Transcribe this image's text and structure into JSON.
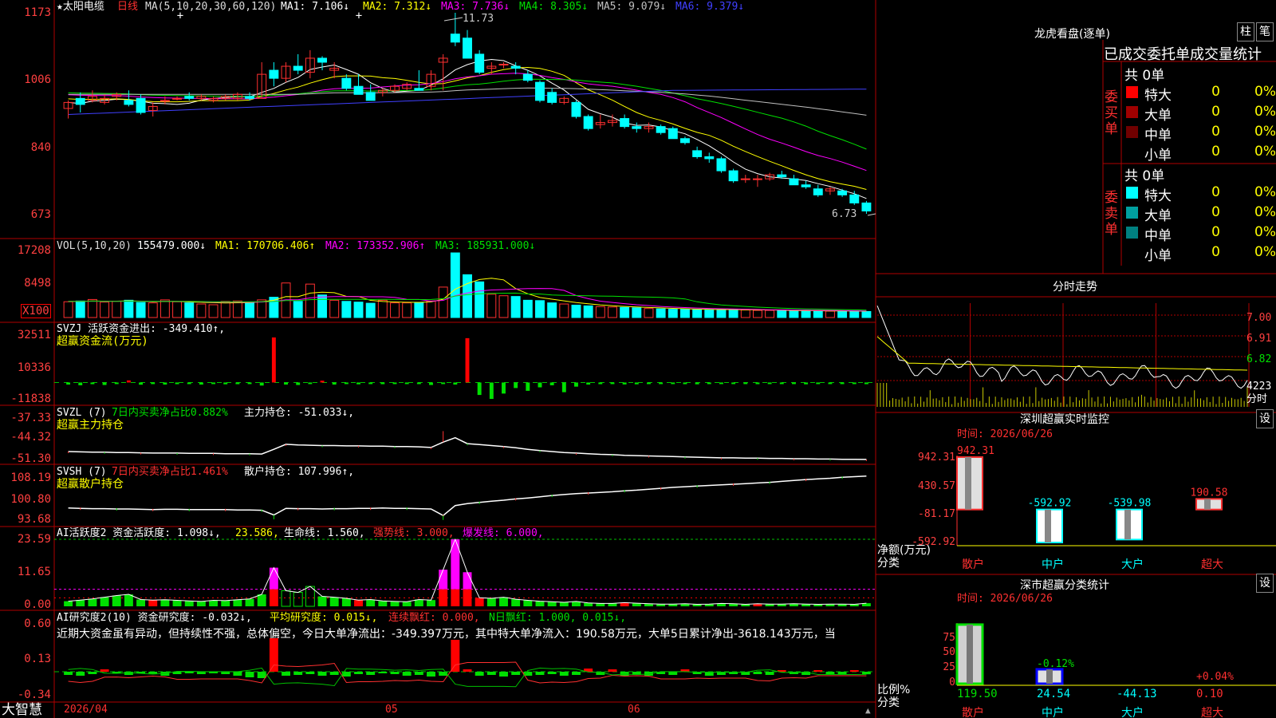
{
  "header": {
    "stock": "★太阳电缆",
    "period": "日线",
    "ma_params": "MA(5,10,20,30,60,120)",
    "ma_items": [
      {
        "label": "MA1: 7.106↓",
        "color": "#ffffff"
      },
      {
        "label": "MA2: 7.312↓",
        "color": "#ffff00"
      },
      {
        "label": "MA3: 7.736↓",
        "color": "#ff00ff"
      },
      {
        "label": "MA4: 8.305↓",
        "color": "#00e000"
      },
      {
        "label": "MA5: 9.079↓",
        "color": "#c0c0c0"
      },
      {
        "label": "MA6: 9.379↓",
        "color": "#4040ff"
      }
    ],
    "high_mark": "11.73",
    "low_mark": "6.73"
  },
  "price_axis": [
    "1173",
    "1006",
    "840",
    "673"
  ],
  "volume": {
    "header": "VOL(5,10,20)",
    "value": "155479.000↓",
    "items": [
      {
        "label": "MA1: 170706.406↑",
        "color": "#ffff00"
      },
      {
        "label": "MA2: 173352.906↑",
        "color": "#ff00ff"
      },
      {
        "label": "MA3: 185931.000↓",
        "color": "#00e000"
      }
    ],
    "axis": [
      "17208",
      "8498"
    ],
    "unit": "X100"
  },
  "svzj": {
    "header": "SVZJ  活跃资金进出: -349.410↑,",
    "sub": "超赢资金流(万元)",
    "axis": [
      "32511",
      "10336",
      "-11838"
    ]
  },
  "svzl": {
    "header_a": "SVZL (7)",
    "header_b": "7日内买卖净占比0.882%",
    "header_c": "主力持仓: -51.033↓,",
    "sub": "超赢主力持仓",
    "axis": [
      "-37.33",
      "-44.32",
      "-51.30"
    ]
  },
  "svsh": {
    "header_a": "SVSH (7)",
    "header_b": "7日内买卖净占比1.461%",
    "header_c": "散户持仓: 107.996↑,",
    "sub": "超赢散户持仓",
    "axis": [
      "108.19",
      "100.80",
      "93.68"
    ]
  },
  "ai_active": {
    "header_a": "AI活跃度2 资金活跃度: 1.098↓,",
    "header_b": "23.586,",
    "header_c": "生命线: 1.560,",
    "header_d": "强势线: 3.000,",
    "header_e": "爆发线: 6.000,",
    "axis": [
      "23.59",
      "11.65",
      "0.00"
    ]
  },
  "ai_research": {
    "header_a": "AI研究度2(10) 资金研究度: -0.032↓,",
    "header_b": "平均研究度: 0.015↓,",
    "header_c": "连续飘红: 0.000,",
    "header_d": "N日飘红: 1.000, 0.015↓,",
    "text": "近期大资金虽有异动，但持续性不强，总体偏空，今日大单净流出：-349.397万元，其中特大单净流入：190.58万元，大单5日累计净出-3618.143万元，当",
    "axis": [
      "0.60",
      "0.13",
      "-0.34"
    ]
  },
  "footer": {
    "brand": "大智慧",
    "dates": [
      "2026/04",
      "05",
      "06"
    ]
  },
  "right": {
    "dragon_title": "龙虎看盘(逐单)",
    "btn_zhu": "柱",
    "btn_bi": "笔",
    "order_title": "已成交委托单成交量统计",
    "buy_total": "共 0单",
    "buy_label": "委买单",
    "sell_total": "共 0单",
    "sell_label": "委卖单",
    "buy_rows": [
      {
        "name": "特大",
        "value": "0",
        "pct": "0%",
        "color": "#ff0000"
      },
      {
        "name": "大单",
        "value": "0",
        "pct": "0%",
        "color": "#a00000"
      },
      {
        "name": "中单",
        "value": "0",
        "pct": "0%",
        "color": "#700000"
      },
      {
        "name": "小单",
        "value": "0",
        "pct": "0%",
        "color": ""
      }
    ],
    "sell_rows": [
      {
        "name": "特大",
        "value": "0",
        "pct": "0%",
        "color": "#00ffff"
      },
      {
        "name": "大单",
        "value": "0",
        "pct": "0%",
        "color": "#00a0a0"
      },
      {
        "name": "中单",
        "value": "0",
        "pct": "0%",
        "color": "#008080"
      },
      {
        "name": "小单",
        "value": "0",
        "pct": "0%",
        "color": ""
      }
    ],
    "intraday_title": "分时走势",
    "intraday_axis": [
      "7.00",
      "6.91",
      "6.82"
    ],
    "intraday_vol": "4223",
    "intraday_unit": "分时",
    "monitor_title": "深圳超赢实时监控",
    "monitor_btn": "设",
    "monitor_time": "时间: 2026/06/26",
    "monitor_axis": [
      "942.31",
      "430.57",
      "-81.17",
      "-592.92"
    ],
    "monitor_ylabel": "净额(万元)",
    "monitor_xlabel": "分类",
    "class_title": "深市超赢分类统计",
    "class_btn": "设",
    "class_time": "时间: 2026/06/26",
    "class_axis": [
      "75",
      "50",
      "25",
      "0"
    ],
    "class_ylabel": "比例%",
    "class_xlabel": "分类"
  },
  "chart_data": [
    {
      "type": "candlestick",
      "title": "太阳电缆 日线",
      "ylim": [
        6.73,
        11.73
      ],
      "ohlc": [
        [
          9.35,
          9.55,
          9.1,
          9.5
        ],
        [
          9.6,
          9.75,
          9.25,
          9.45
        ],
        [
          9.55,
          9.8,
          9.5,
          9.65
        ],
        [
          9.5,
          9.7,
          9.45,
          9.6
        ],
        [
          9.65,
          9.75,
          9.55,
          9.7
        ],
        [
          9.55,
          9.8,
          9.4,
          9.45
        ],
        [
          9.6,
          9.7,
          9.2,
          9.25
        ],
        [
          9.3,
          9.5,
          9.15,
          9.4
        ],
        [
          9.55,
          9.65,
          9.45,
          9.55
        ],
        [
          9.6,
          9.65,
          9.55,
          9.6
        ],
        [
          9.65,
          9.75,
          9.55,
          9.6
        ],
        [
          9.6,
          9.7,
          9.55,
          9.65
        ],
        [
          9.55,
          9.65,
          9.5,
          9.6
        ],
        [
          9.6,
          9.7,
          9.55,
          9.65
        ],
        [
          9.6,
          9.75,
          9.55,
          9.7
        ],
        [
          9.65,
          9.75,
          9.55,
          9.6
        ],
        [
          9.6,
          10.5,
          9.6,
          10.2
        ],
        [
          10.3,
          10.5,
          9.9,
          10.1
        ],
        [
          10.1,
          10.5,
          10.0,
          10.4
        ],
        [
          10.4,
          10.7,
          10.2,
          10.3
        ],
        [
          10.25,
          10.8,
          10.1,
          10.6
        ],
        [
          10.6,
          10.65,
          10.3,
          10.5
        ],
        [
          10.3,
          10.5,
          10.1,
          10.35
        ],
        [
          10.1,
          10.2,
          9.8,
          9.85
        ],
        [
          9.9,
          10.2,
          9.75,
          9.7
        ],
        [
          9.75,
          9.95,
          9.6,
          9.55
        ],
        [
          9.75,
          9.85,
          9.65,
          9.8
        ],
        [
          9.8,
          9.95,
          9.75,
          9.9
        ],
        [
          9.85,
          10.0,
          9.8,
          9.95
        ],
        [
          9.85,
          10.3,
          9.8,
          9.8
        ],
        [
          9.9,
          10.3,
          9.8,
          10.2
        ],
        [
          10.5,
          10.7,
          9.8,
          10.6
        ],
        [
          11.2,
          11.73,
          10.9,
          11.0
        ],
        [
          11.1,
          11.3,
          10.6,
          10.6
        ],
        [
          10.7,
          10.8,
          10.2,
          10.25
        ],
        [
          10.35,
          10.5,
          10.2,
          10.4
        ],
        [
          10.45,
          10.5,
          10.35,
          10.45
        ],
        [
          10.4,
          10.5,
          10.2,
          10.35
        ],
        [
          10.2,
          10.3,
          10.0,
          10.05
        ],
        [
          10.0,
          10.05,
          9.5,
          9.55
        ],
        [
          9.75,
          9.85,
          9.45,
          9.5
        ],
        [
          9.5,
          9.65,
          9.45,
          9.6
        ],
        [
          9.5,
          9.55,
          9.1,
          9.15
        ],
        [
          9.15,
          9.2,
          8.8,
          8.85
        ],
        [
          8.95,
          9.2,
          8.85,
          9.0
        ],
        [
          9.0,
          9.2,
          8.9,
          9.05
        ],
        [
          9.1,
          9.2,
          8.85,
          8.9
        ],
        [
          8.9,
          9.0,
          8.75,
          8.85
        ],
        [
          8.85,
          9.0,
          8.75,
          8.9
        ],
        [
          8.9,
          8.95,
          8.7,
          8.75
        ],
        [
          8.85,
          8.9,
          8.6,
          8.6
        ],
        [
          8.6,
          8.65,
          8.45,
          8.5
        ],
        [
          8.3,
          8.4,
          8.1,
          8.15
        ],
        [
          8.15,
          8.25,
          8.0,
          8.1
        ],
        [
          8.1,
          8.15,
          7.75,
          7.8
        ],
        [
          7.8,
          7.85,
          7.5,
          7.55
        ],
        [
          7.6,
          7.7,
          7.5,
          7.6
        ],
        [
          7.6,
          7.7,
          7.4,
          7.6
        ],
        [
          7.6,
          7.75,
          7.55,
          7.7
        ],
        [
          7.7,
          7.8,
          7.6,
          7.65
        ],
        [
          7.6,
          7.7,
          7.45,
          7.45
        ],
        [
          7.45,
          7.55,
          7.35,
          7.4
        ],
        [
          7.35,
          7.45,
          7.15,
          7.2
        ],
        [
          7.3,
          7.4,
          7.2,
          7.35
        ],
        [
          7.3,
          7.35,
          7.15,
          7.2
        ],
        [
          7.2,
          7.3,
          6.95,
          7.0
        ],
        [
          7.0,
          7.05,
          6.73,
          6.8
        ]
      ]
    },
    {
      "type": "bar",
      "title": "VOL",
      "values": [
        4200,
        4400,
        4800,
        4100,
        4300,
        4600,
        4000,
        3900,
        4700,
        4200,
        3900,
        3600,
        3400,
        4300,
        4400,
        4100,
        4700,
        5400,
        9200,
        4300,
        8900,
        6000,
        4600,
        4300,
        4100,
        3800,
        4600,
        3900,
        3900,
        4000,
        4400,
        8100,
        17208,
        11400,
        9500,
        6200,
        5800,
        5600,
        4600,
        4500,
        3900,
        3600,
        3300,
        3100,
        2900,
        2800,
        2700,
        2600,
        2400,
        2300,
        2200,
        2200,
        2100,
        2000,
        2100,
        2200,
        2000,
        1900,
        1900,
        1800,
        1700,
        1800,
        1800,
        1700,
        1700,
        1600,
        1600
      ]
    },
    {
      "type": "bar",
      "title": "SVZJ",
      "values": [
        -1500,
        -2000,
        -1200,
        -1800,
        -900,
        1500,
        -1600,
        -800,
        -1500,
        -1200,
        -1000,
        -1500,
        -900,
        -1300,
        -1200,
        -1000,
        -2200,
        32511,
        -1500,
        -1800,
        -1000,
        1300,
        -1500,
        -900,
        -1300,
        -1000,
        -1200,
        -900,
        -1000,
        -1100,
        -1800,
        -800,
        -1500,
        32000,
        -9000,
        -11838,
        -8000,
        -4000,
        -6000,
        -3500,
        -2000,
        -7000,
        -3000,
        -1500,
        -1200,
        -1000,
        -1400,
        -1300,
        -900,
        -1000,
        -1100,
        -1200,
        -1300,
        -1000,
        -900,
        -1100,
        -1000,
        -1200,
        -900,
        -1000,
        -1100,
        -1300,
        -1000,
        -1100,
        -900,
        -1000,
        -1200
      ]
    },
    {
      "type": "line",
      "title": "SVZL",
      "values": [
        -48.5,
        -48.6,
        -48.7,
        -48.7,
        -48.8,
        -48.8,
        -48.9,
        -49.0,
        -49.0,
        -49.0,
        -49.1,
        -49.1,
        -49.1,
        -49.2,
        -49.2,
        -49.2,
        -49.3,
        -47.8,
        -46.2,
        -46.4,
        -46.5,
        -46.6,
        -46.6,
        -46.7,
        -46.7,
        -46.8,
        -46.8,
        -46.9,
        -46.9,
        -47.0,
        -47.2,
        -45.5,
        -44.1,
        -46.0,
        -46.3,
        -46.6,
        -46.9,
        -47.3,
        -47.8,
        -48.2,
        -48.5,
        -48.8,
        -49.0,
        -49.2,
        -49.4,
        -49.5,
        -49.7,
        -49.8,
        -49.9,
        -50.0,
        -50.1,
        -50.2,
        -50.3,
        -50.4,
        -50.5,
        -50.5,
        -50.6,
        -50.6,
        -50.7,
        -50.7,
        -50.8,
        -50.8,
        -50.9,
        -50.9,
        -51.0,
        -51.0,
        -51.03
      ]
    },
    {
      "type": "line",
      "title": "SVSH",
      "values": [
        97.8,
        97.7,
        97.6,
        97.6,
        97.5,
        97.5,
        97.4,
        97.3,
        97.4,
        97.4,
        97.3,
        97.3,
        97.3,
        97.3,
        97.2,
        97.2,
        97.1,
        95.6,
        97.7,
        97.6,
        97.6,
        97.5,
        97.6,
        97.6,
        97.7,
        97.7,
        97.8,
        97.7,
        97.7,
        97.6,
        97.5,
        95.4,
        98.6,
        99.2,
        99.6,
        100.0,
        100.3,
        100.7,
        101.0,
        101.4,
        101.8,
        102.1,
        102.4,
        102.6,
        102.8,
        103.0,
        103.3,
        103.5,
        103.8,
        104.1,
        104.4,
        104.6,
        104.8,
        105.0,
        105.2,
        105.4,
        105.6,
        105.8,
        106.0,
        106.3,
        106.6,
        106.9,
        107.1,
        107.3,
        107.6,
        107.8,
        108.0
      ]
    },
    {
      "type": "bar",
      "title": "AI活跃度2",
      "values": [
        1.8,
        2.2,
        2.6,
        3.2,
        3.8,
        4.2,
        2.4,
        2.2,
        2.3,
        2.1,
        1.9,
        1.7,
        2.1,
        2.0,
        2.3,
        2.6,
        4.2,
        13.6,
        5.5,
        4.9,
        7.0,
        3.5,
        3.2,
        2.8,
        2.2,
        2.4,
        1.9,
        1.7,
        1.6,
        2.4,
        2.2,
        12.9,
        23.59,
        12.0,
        3.0,
        2.8,
        3.2,
        2.5,
        2.1,
        1.8,
        1.6,
        1.4,
        1.7,
        1.2,
        1.0,
        1.0,
        1.3,
        1.1,
        0.9,
        0.8,
        0.8,
        0.9,
        0.7,
        0.8,
        1.0,
        0.9,
        0.7,
        0.9,
        0.8,
        0.8,
        0.9,
        0.8,
        0.7,
        0.8,
        0.8,
        0.7,
        1.098
      ]
    },
    {
      "type": "bar",
      "title": "AI研究度2",
      "values": [
        -0.04,
        -0.05,
        -0.03,
        0.03,
        -0.02,
        -0.04,
        -0.02,
        -0.03,
        -0.05,
        -0.03,
        -0.02,
        -0.03,
        -0.02,
        -0.03,
        -0.05,
        -0.07,
        -0.08,
        0.42,
        -0.05,
        -0.04,
        -0.03,
        -0.05,
        -0.04,
        -0.06,
        -0.03,
        -0.04,
        -0.02,
        -0.03,
        -0.05,
        -0.04,
        -0.06,
        -0.05,
        0.4,
        0.03,
        -0.05,
        -0.04,
        -0.06,
        -0.04,
        -0.05,
        -0.04,
        -0.03,
        -0.05,
        -0.04,
        0.04,
        -0.04,
        0.03,
        -0.05,
        -0.04,
        -0.05,
        -0.03,
        -0.04,
        0.03,
        -0.03,
        -0.05,
        -0.04,
        -0.03,
        -0.04,
        -0.03,
        -0.04,
        0.02,
        -0.03,
        -0.04,
        0.02,
        -0.03,
        -0.04,
        0.02,
        -0.032
      ]
    },
    {
      "type": "bar",
      "title": "深圳超赢实时监控",
      "categories": [
        "散户",
        "中户",
        "大户",
        "超大"
      ],
      "values": [
        942.31,
        -592.92,
        -539.98,
        190.58
      ],
      "ylim": [
        -592.92,
        942.31
      ]
    },
    {
      "type": "bar",
      "title": "深市超赢分类统计",
      "categories": [
        "散户",
        "中户",
        "大户",
        "超大"
      ],
      "values": [
        119.5,
        24.54,
        -44.13,
        0.1
      ],
      "labels": [
        "119.50",
        "24.54",
        "-44.13",
        "0.10"
      ],
      "pct": [
        "",
        "-0.12%",
        "",
        "+0.04%"
      ]
    }
  ]
}
